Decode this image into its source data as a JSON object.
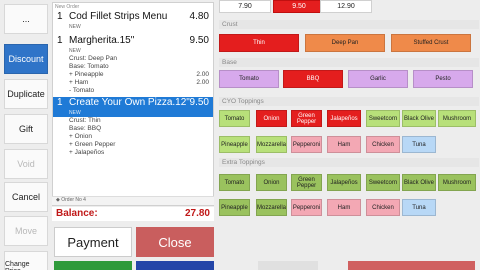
{
  "left_buttons": {
    "top": "...",
    "discount": "Discount",
    "duplicate": "Duplicate",
    "gift": "Gift",
    "void": "Void",
    "cancel": "Cancel",
    "move": "Move",
    "change_price": "Change Price"
  },
  "order": {
    "header": "New Order",
    "items": [
      {
        "qty": "1",
        "name": "Cod Fillet Strips Menu",
        "price": "4.80",
        "tag": "NEW"
      },
      {
        "qty": "1",
        "name": "Margherita.15\"",
        "price": "9.50",
        "tag": "NEW"
      }
    ],
    "margherita_mods": [
      {
        "text": "Crust: Deep Pan",
        "price": ""
      },
      {
        "text": "Base: Tomato",
        "price": ""
      },
      {
        "text": "+ Pineapple",
        "price": "2.00"
      },
      {
        "text": "+ Ham",
        "price": "2.00"
      },
      {
        "text": "- Tomato",
        "price": ""
      }
    ],
    "selected": {
      "qty": "1",
      "name": "Create Your Own Pizza.12\"",
      "price": "9.50",
      "tag": "NEW"
    },
    "selected_mods": [
      {
        "text": "Crust: Thin"
      },
      {
        "text": "Base: BBQ"
      },
      {
        "text": "+ Onion"
      },
      {
        "text": "+ Green Pepper"
      },
      {
        "text": "+ Jalapeños"
      }
    ],
    "order_no": "Order No 4",
    "balance_label": "Balance:",
    "balance_value": "27.80"
  },
  "actions": {
    "payment": "Payment",
    "close": "Close"
  },
  "sizes": [
    {
      "label": "7.90",
      "selected": false
    },
    {
      "label": "9.50",
      "selected": true
    },
    {
      "label": "12.90",
      "selected": false
    }
  ],
  "sections": {
    "crust": "Crust",
    "base": "Base",
    "cyo": "CYO Toppings",
    "extra": "Extra Toppings"
  },
  "crusts": [
    {
      "label": "Thin",
      "selected": true
    },
    {
      "label": "Deep Pan",
      "selected": false
    },
    {
      "label": "Stuffed Crust",
      "selected": false
    }
  ],
  "bases": [
    {
      "label": "Tomato",
      "selected": false
    },
    {
      "label": "BBQ",
      "selected": true
    },
    {
      "label": "Garlic",
      "selected": false
    },
    {
      "label": "Pesto",
      "selected": false
    }
  ],
  "cyo_row1": [
    "Tomato",
    "Onion",
    "Green Pepper",
    "Jalapeños",
    "Sweetcorn",
    "Black Olive",
    "Mushroom"
  ],
  "cyo_row2": [
    "Pineapple",
    "Mozzarella",
    "Pepperoni",
    "Ham",
    "Chicken",
    "Tuna"
  ],
  "extra_row1": [
    "Tomato",
    "Onion",
    "Green Pepper",
    "Jalapeños",
    "Sweetcorn",
    "Black Olive",
    "Mushroom"
  ],
  "extra_row2": [
    "Pineapple",
    "Mozzarella",
    "Pepperoni",
    "Ham",
    "Chicken",
    "Tuna"
  ],
  "colors": {
    "accent": "#1f7ad6",
    "selected": "#e41e1e",
    "close": "#c95e5e",
    "balance": "#c01818"
  }
}
